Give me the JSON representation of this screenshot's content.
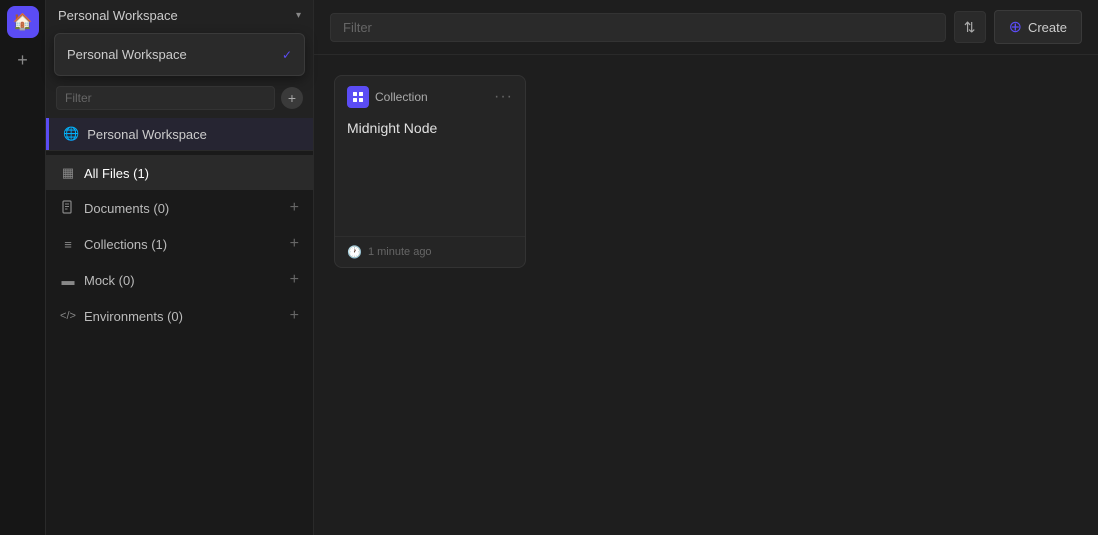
{
  "iconBar": {
    "homeLabel": "🏠",
    "addLabel": "+"
  },
  "workspaceDropdown": {
    "title": "Personal Workspace",
    "chevron": "▾",
    "menuItem": {
      "label": "Personal Workspace",
      "checked": true,
      "checkMark": "✓"
    }
  },
  "sidebar": {
    "filterPlaceholder": "Filter",
    "workspaceItem": {
      "label": "Personal Workspace",
      "icon": "🌐"
    },
    "navItems": [
      {
        "id": "all-files",
        "label": "All Files (1)",
        "icon": "▦",
        "active": true,
        "hasAdd": false
      },
      {
        "id": "documents",
        "label": "Documents (0)",
        "icon": "📄",
        "active": false,
        "hasAdd": true
      },
      {
        "id": "collections",
        "label": "Collections (1)",
        "icon": "≡",
        "active": false,
        "hasAdd": true
      },
      {
        "id": "mock",
        "label": "Mock (0)",
        "icon": "▬",
        "active": false,
        "hasAdd": true
      },
      {
        "id": "environments",
        "label": "Environments (0)",
        "icon": "</>",
        "active": false,
        "hasAdd": true
      }
    ]
  },
  "toolbar": {
    "filterPlaceholder": "Filter",
    "sortIcon": "⇅",
    "createButtonLabel": "Create",
    "createPlusIcon": "⊕"
  },
  "cards": [
    {
      "id": "midnight-node",
      "typeLabel": "Collection",
      "title": "Midnight Node",
      "timestamp": "1 minute ago",
      "menuIcon": "•••"
    }
  ]
}
